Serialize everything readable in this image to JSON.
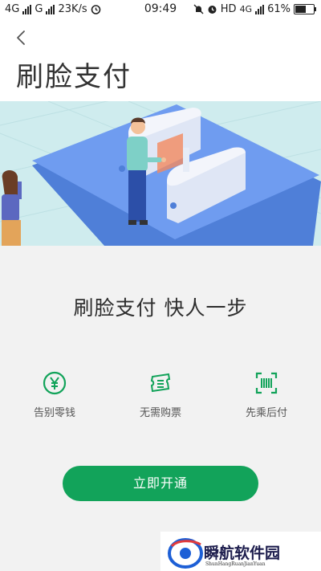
{
  "status_bar": {
    "net1": "4G",
    "net2": "G",
    "speed": "23K/s",
    "time": "09:49",
    "hd": "HD",
    "net3": "4G",
    "battery_percent": "61%",
    "battery_level": 0.61
  },
  "header": {
    "title": "刷脸支付"
  },
  "slogan": "刷脸支付 快人一步",
  "features": [
    {
      "label": "告别零钱",
      "icon": "yen-coin-icon"
    },
    {
      "label": "无需购票",
      "icon": "ticket-icon"
    },
    {
      "label": "先乘后付",
      "icon": "barcode-scan-icon"
    }
  ],
  "cta_label": "立即开通",
  "watermark": {
    "name": "瞬航软件园",
    "pinyin": "ShunHangRuanJianYuan"
  },
  "colors": {
    "accent": "#12a35a",
    "hero_bg": "#cfecee",
    "platform": "#6f9cf0"
  }
}
